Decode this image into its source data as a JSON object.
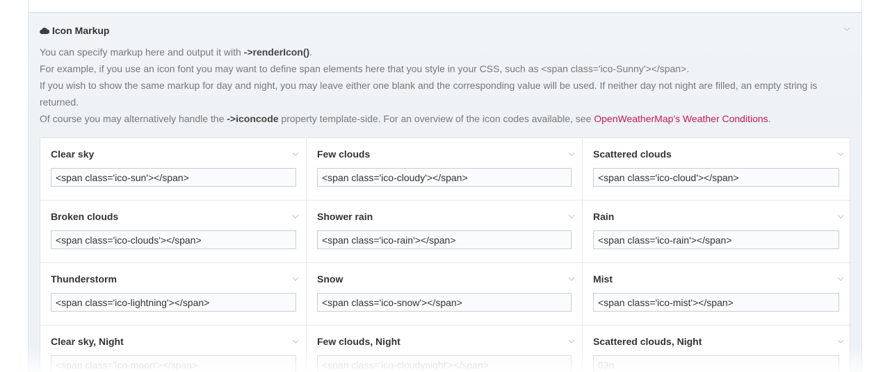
{
  "section": {
    "title": "Icon Markup",
    "icon": "cloud-icon"
  },
  "description": {
    "line1_prefix": "You can specify markup here and output it with ",
    "line1_code": "->renderIcon()",
    "line1_suffix": ".",
    "line2": "For example, if you use an icon font you may want to define span elements here that you style in your CSS, such as <span class='ico-Sunny'></span>.",
    "line3": "If you wish to show the same markup for day and night, you may leave either one blank and the corresponding value will be used. If neither day not night are filled, an empty string is returned.",
    "line4_prefix": "Of course you may alternatively handle the ",
    "line4_code": "->iconcode",
    "line4_middle": " property template-side. For an overview of the icon codes available, see ",
    "line4_link": "OpenWeatherMap's Weather Conditions",
    "line4_suffix": "."
  },
  "fields": [
    {
      "label": "Clear sky",
      "value": "<span class='ico-sun'></span>",
      "placeholder": ""
    },
    {
      "label": "Few clouds",
      "value": "<span class='ico-cloudy'></span>",
      "placeholder": ""
    },
    {
      "label": "Scattered clouds",
      "value": "<span class='ico-cloud'></span>",
      "placeholder": ""
    },
    {
      "label": "Broken clouds",
      "value": "<span class='ico-clouds'></span>",
      "placeholder": ""
    },
    {
      "label": "Shower rain",
      "value": "<span class='ico-rain'></span>",
      "placeholder": ""
    },
    {
      "label": "Rain",
      "value": "<span class='ico-rain'></span>",
      "placeholder": ""
    },
    {
      "label": "Thunderstorm",
      "value": "<span class='ico-lightning'></span>",
      "placeholder": ""
    },
    {
      "label": "Snow",
      "value": "<span class='ico-snow'></span>",
      "placeholder": ""
    },
    {
      "label": "Mist",
      "value": "<span class='ico-mist'></span>",
      "placeholder": ""
    },
    {
      "label": "Clear sky, Night",
      "value": "",
      "placeholder": "<span class='ico-moon'></span>"
    },
    {
      "label": "Few clouds, Night",
      "value": "",
      "placeholder": "<span class='ico-cloudynight'></span>"
    },
    {
      "label": "Scattered clouds, Night",
      "value": "",
      "placeholder": "03n"
    }
  ],
  "colors": {
    "link": "#c2185b",
    "label": "#333333",
    "muted": "#777777"
  }
}
